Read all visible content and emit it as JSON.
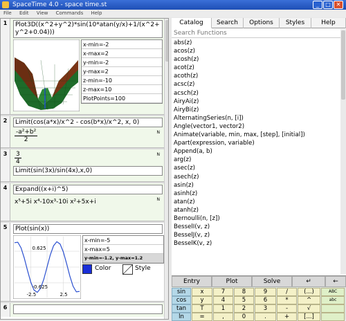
{
  "window": {
    "title": "SpaceTime 4.0 - space time.st",
    "min": "_",
    "max": "□",
    "close": "✕"
  },
  "menu": [
    "File",
    "Edit",
    "View",
    "Commands",
    "Help"
  ],
  "cells": [
    {
      "num": "1",
      "input_line1": "Plot3D((x^2+y^2)*sin(10*atan(y/x)+1/(x^2+",
      "input_line2": "y^2+0.04)))",
      "params": [
        "x-min=-2",
        "x-max=2",
        "y-min=-2",
        "y-max=2",
        "z-min=-10",
        "z-max=10",
        "PlotPoints=100"
      ]
    },
    {
      "num": "2",
      "input": "Limit(cos(a*x)/x^2 - cos(b*x)/x^2, x, 0)",
      "result_num": "-a²+b²",
      "result_den": "2",
      "mark": "N"
    },
    {
      "num": "3",
      "input": "Limit(sin(3x)/sin(4x),x,0)",
      "result_num": "3",
      "result_den": "4",
      "mark": "N"
    },
    {
      "num": "4",
      "input": "Expand((x+i)^5)",
      "result": "x⁵+5i x⁴-10x³-10i x²+5x+i",
      "mark": "N"
    },
    {
      "num": "5",
      "input": "Plot(sin(x))",
      "params": [
        "x-min=-5",
        "x-max=5"
      ],
      "range_note": "y-min=-1.2, y-max=1.2",
      "axis_labels": {
        "y_top": "0.625",
        "y_bottom": "-0.625",
        "x_left": "-2.5",
        "x_right": "2.5"
      },
      "color_label": "Color",
      "style_label": "Style"
    },
    {
      "num": "6",
      "input": ""
    }
  ],
  "tabs": [
    "Catalog",
    "Search",
    "Options",
    "Styles",
    "Help"
  ],
  "search_placeholder": "Search Functions",
  "functions": [
    "abs(z)",
    "acos(z)",
    "acosh(z)",
    "acot(z)",
    "acoth(z)",
    "acsc(z)",
    "acsch(z)",
    "AiryAi(z)",
    "AiryBi(z)",
    "AlternatingSeries(n, [i])",
    "Angle(vector1, vector2)",
    "Animate(variable, min, max, [step], [initial])",
    "Apart(expression, variable)",
    "Append(a, b)",
    "arg(z)",
    "asec(z)",
    "asech(z)",
    "asin(z)",
    "asinh(z)",
    "atan(z)",
    "atanh(z)",
    "Bernoulli(n, [z])",
    "BesselI(v, z)",
    "BesselJ(v, z)",
    "BesselK(v, z)"
  ],
  "keypad": {
    "top": [
      "Entry",
      "Plot",
      "Solve",
      "↵",
      "←"
    ],
    "rows": [
      [
        "sin",
        "x",
        "7",
        "8",
        "9",
        "/",
        "(...)",
        "ABC"
      ],
      [
        "cos",
        "y",
        "4",
        "5",
        "6",
        "*",
        "^",
        "abc"
      ],
      [
        "tan",
        "T",
        "1",
        "2",
        "3",
        "-",
        "√",
        ""
      ],
      [
        "ln",
        "=",
        ",",
        "0",
        ".",
        "+",
        "[...]",
        ""
      ]
    ]
  },
  "colors": {
    "accent_blue": "#1e4fb5",
    "cell_bg": "#f0f8ea",
    "plot_curve": "#2a4fd0",
    "key_yellow": "#f4f1c8",
    "key_blue": "#b4d8e8"
  },
  "chart_data": {
    "type": "line",
    "title": "",
    "xlabel": "",
    "ylabel": "",
    "xlim": [
      -5,
      5
    ],
    "ylim": [
      -1.2,
      1.2
    ],
    "x": [
      -5,
      -4.5,
      -4,
      -3.5,
      -3,
      -2.5,
      -2,
      -1.5,
      -1,
      -0.5,
      0,
      0.5,
      1,
      1.5,
      2,
      2.5,
      3,
      3.5,
      4,
      4.5,
      5
    ],
    "series": [
      {
        "values": [
          0.959,
          0.978,
          0.757,
          0.351,
          -0.141,
          -0.598,
          -0.909,
          -0.997,
          -0.841,
          -0.479,
          0,
          0.479,
          0.841,
          0.997,
          0.909,
          0.598,
          0.141,
          -0.351,
          -0.757,
          -0.978,
          -0.959
        ]
      }
    ],
    "xticks": [
      "-2.5",
      "2.5"
    ],
    "yticks": [
      "0.625",
      "-0.625"
    ]
  }
}
